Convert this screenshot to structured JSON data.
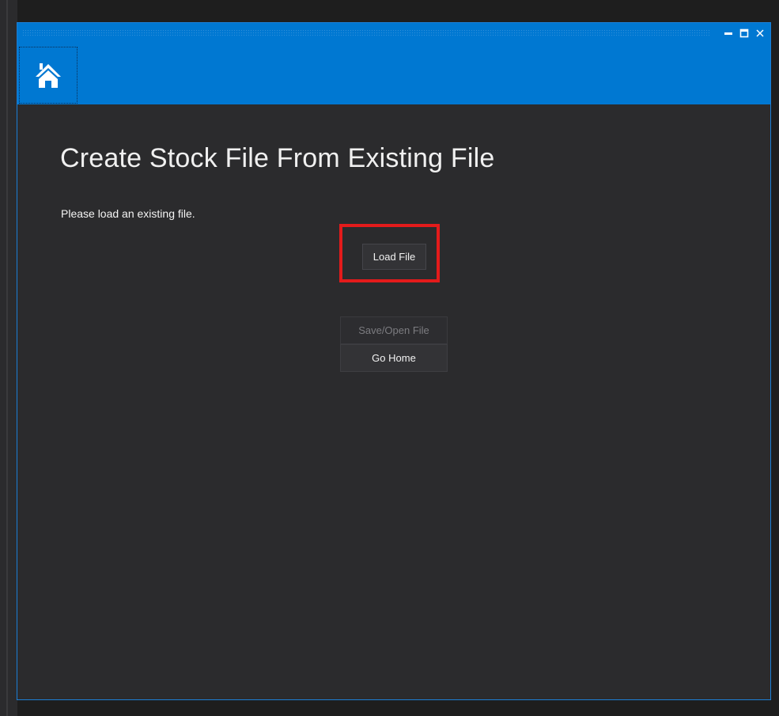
{
  "window": {
    "icons": {
      "home": "home-icon",
      "minimize": "minimize-icon",
      "maximize": "maximize-icon",
      "close": "close-icon"
    },
    "colors": {
      "titlebar": "#0078d2",
      "background": "#2b2b2d",
      "highlight": "#e31b1b"
    }
  },
  "main": {
    "title": "Create Stock File From Existing File",
    "instruction": "Please load an existing file.",
    "load_button_label": "Load File",
    "save_open_button_label": "Save/Open File",
    "go_home_button_label": "Go Home"
  }
}
